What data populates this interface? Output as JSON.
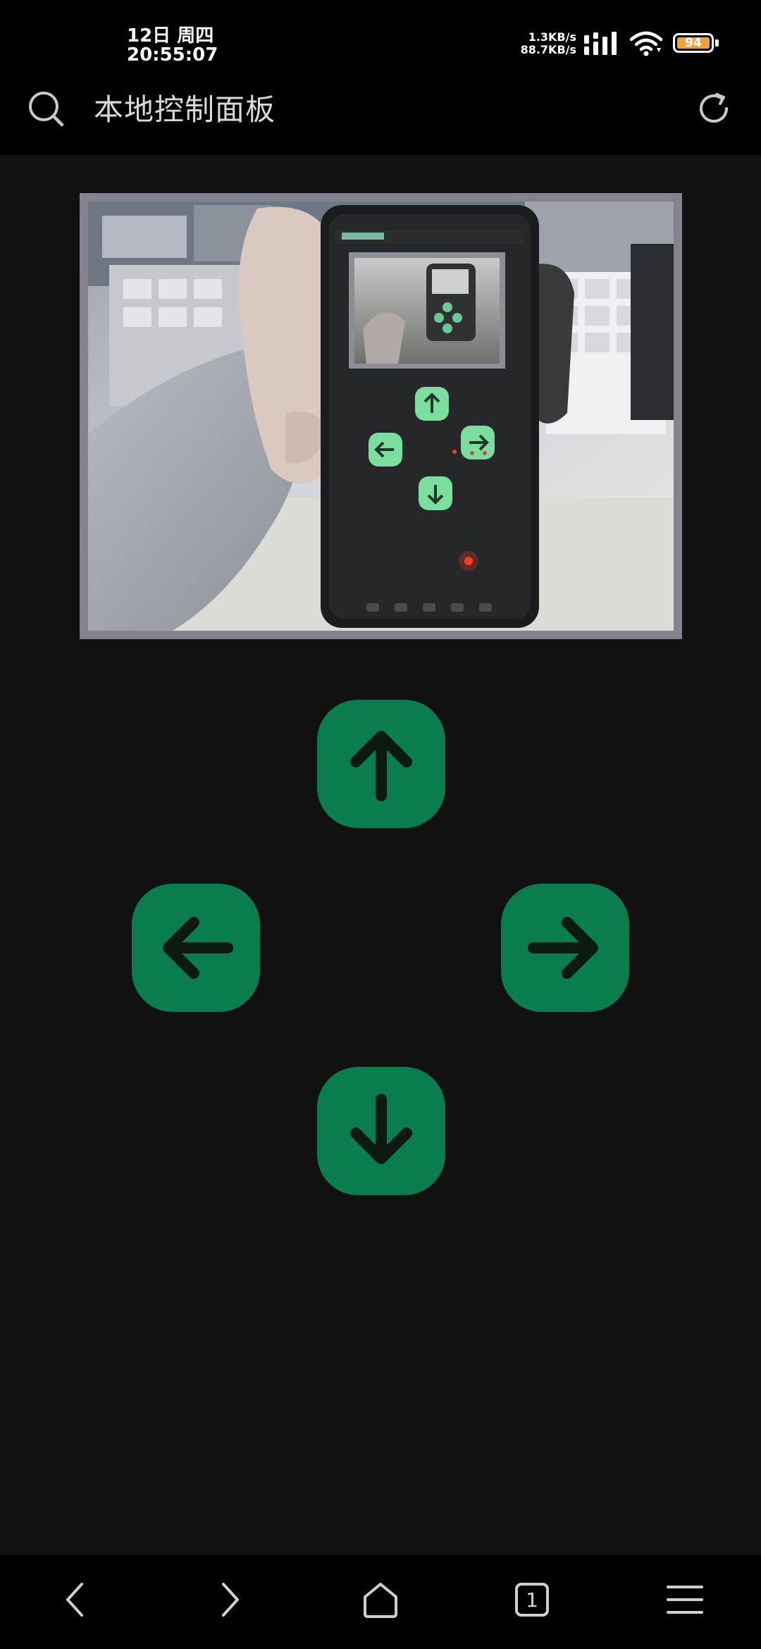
{
  "status_bar": {
    "date": "12日 周四",
    "time": "20:55:07",
    "upload_speed": "1.3KB/s",
    "download_speed": "88.7KB/s",
    "battery_level": "94",
    "battery_color": "#f0a33b"
  },
  "header": {
    "title": "本地控制面板",
    "search_icon": "search-icon",
    "refresh_icon": "refresh-icon"
  },
  "camera": {
    "description_icon": "camera-feed"
  },
  "controls": {
    "up_icon": "arrow-up-icon",
    "left_icon": "arrow-left-icon",
    "right_icon": "arrow-right-icon",
    "down_icon": "arrow-down-icon",
    "button_color": "#0a7d4f"
  },
  "bottom_nav": {
    "tab_count": "1"
  }
}
